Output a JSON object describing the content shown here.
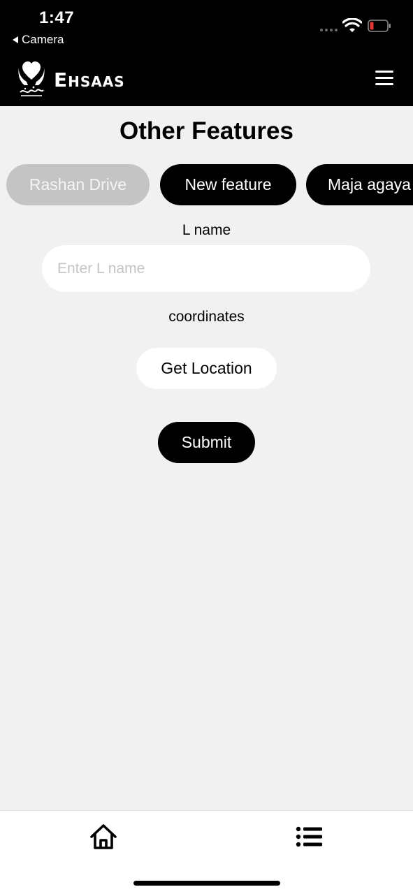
{
  "status_bar": {
    "time": "1:47",
    "back_app": "Camera"
  },
  "header": {
    "brand_initial": "E",
    "brand_rest": "HSAAS",
    "logo_icon": "ehsaas-hands-heart-logo",
    "menu_icon": "hamburger-menu-icon"
  },
  "page": {
    "title": "Other Features"
  },
  "chips": [
    {
      "label": "Rashan Drive",
      "state": "inactive"
    },
    {
      "label": "New feature",
      "state": "active"
    },
    {
      "label": "Maja agaya",
      "state": "active"
    }
  ],
  "form": {
    "lname_label": "L name",
    "lname_placeholder": "Enter L name",
    "lname_value": "",
    "coordinates_label": "coordinates",
    "get_location_label": "Get Location",
    "submit_label": "Submit"
  },
  "tabbar": {
    "home_icon": "home-icon",
    "list_icon": "list-icon"
  },
  "colors": {
    "header_bg": "#000000",
    "page_bg": "#f1f1f1",
    "chip_inactive_bg": "#c4c4c4",
    "chip_active_bg": "#000000",
    "battery_low": "#e53935"
  }
}
